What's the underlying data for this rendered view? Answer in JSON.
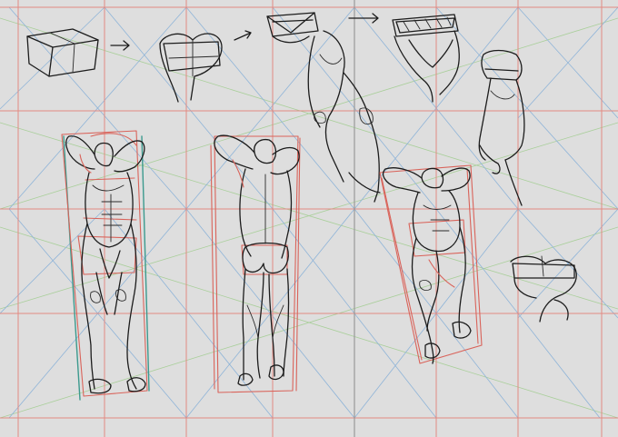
{
  "canvas": {
    "background": "#dedede"
  },
  "colors": {
    "ink": "#1c1c1c",
    "construction_red": "#d9635a",
    "guide_blue": "#8fb4d8",
    "guide_green": "#a9cf9a",
    "guide_teal": "#3c9a8e"
  },
  "icons": [
    "arrow-right-icon",
    "arrow-right-icon",
    "arrow-right-icon"
  ]
}
